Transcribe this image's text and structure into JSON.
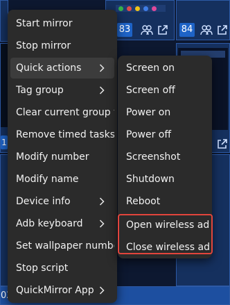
{
  "background": {
    "device_ids": [
      "83",
      "84"
    ],
    "row1_edge": "1",
    "row2_edge": "1",
    "bottom_edge": "02"
  },
  "main_menu": {
    "items": [
      {
        "label": "Start mirror",
        "submenu": false
      },
      {
        "label": "Stop mirror",
        "submenu": false
      },
      {
        "label": "Quick actions",
        "submenu": true,
        "active": true
      },
      {
        "label": "Tag group",
        "submenu": true
      },
      {
        "label": "Clear current group tag",
        "submenu": false
      },
      {
        "label": "Remove timed tasks",
        "submenu": false
      },
      {
        "label": "Modify number",
        "submenu": false
      },
      {
        "label": "Modify name",
        "submenu": false
      },
      {
        "label": "Device info",
        "submenu": true
      },
      {
        "label": "Adb keyboard",
        "submenu": true
      },
      {
        "label": "Set wallpaper number",
        "submenu": false
      },
      {
        "label": "Stop script",
        "submenu": false
      },
      {
        "label": "QuickMirror App",
        "submenu": true
      }
    ]
  },
  "quick_actions_menu": {
    "items": [
      {
        "label": "Screen on"
      },
      {
        "label": "Screen off"
      },
      {
        "label": "Power on"
      },
      {
        "label": "Power off"
      },
      {
        "label": "Screenshot"
      },
      {
        "label": "Shutdown"
      },
      {
        "label": "Reboot"
      },
      {
        "label": "Open wireless adb"
      },
      {
        "label": "Close wireless adb"
      }
    ]
  },
  "icons": {
    "chevron": "chevron-right-icon",
    "group": "people-icon",
    "external": "external-link-icon"
  },
  "colors": {
    "menu_bg": "#2b2b2b",
    "highlight_border": "#e2453c",
    "badge_bg": "#1e63c6"
  }
}
